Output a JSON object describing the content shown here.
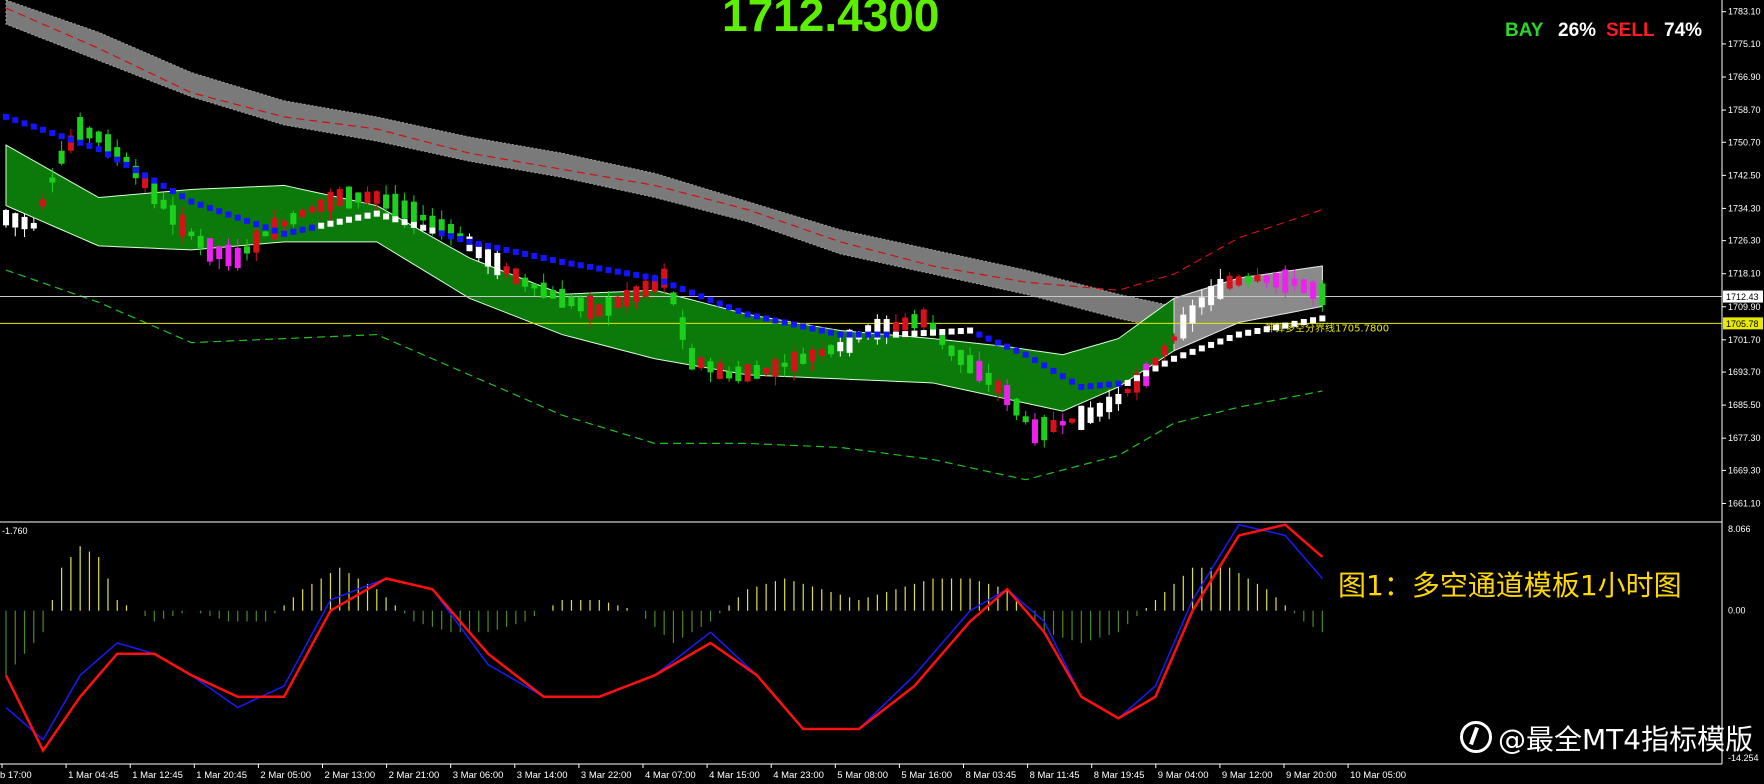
{
  "header": {
    "price": "1712.4300",
    "bay_label": "BAY",
    "bay_pct": "26%",
    "sell_label": "SELL",
    "sell_pct": "74%"
  },
  "colors": {
    "price_text": "#5cf000",
    "bay": "#28d828",
    "sell": "#ff1c1c",
    "channel_fill": "#0b7a0b",
    "cloud_fill": "#7a7a7a",
    "bull_candle": "#d8101a",
    "bear_candle": "#1cd01c",
    "trail_blue": "#1414ff",
    "trail_white": "#ffffff",
    "magenta_candle": "#ee22ee",
    "signal_line": "#ff1010",
    "macd_line": "#1a1aff",
    "hist_pos": "#e0e040",
    "hist_neg": "#4a8a20",
    "current_price_line": "#c8c8c8",
    "dividing_line": "#e8e800"
  },
  "main_axis": {
    "ylim": [
      1657,
      1786
    ],
    "ticks": [
      "1783.10",
      "1775.10",
      "1766.90",
      "1758.70",
      "1750.70",
      "1742.50",
      "1734.30",
      "1726.30",
      "1718.10",
      "1709.90",
      "1701.70",
      "1693.70",
      "1685.50",
      "1677.30",
      "1669.30",
      "1661.10"
    ],
    "current_price": 1712.43,
    "current_price_label": "1712.43",
    "dividing_price": 1705.78,
    "dividing_price_label": "1705.78",
    "dividing_line_text": "神算多空分界线1705.7800"
  },
  "time_axis": [
    "b 17:00",
    "1 Mar 04:45",
    "1 Mar 12:45",
    "1 Mar 20:45",
    "2 Mar 05:00",
    "2 Mar 13:00",
    "2 Mar 21:00",
    "3 Mar 06:00",
    "3 Mar 14:00",
    "3 Mar 22:00",
    "4 Mar 07:00",
    "4 Mar 15:00",
    "4 Mar 23:00",
    "5 Mar 08:00",
    "5 Mar 16:00",
    "8 Mar 03:45",
    "8 Mar 11:45",
    "8 Mar 19:45",
    "9 Mar 04:00",
    "9 Mar 12:00",
    "9 Mar 20:00",
    "10 Mar 05:00"
  ],
  "sub_panel": {
    "left_label": "-1.760",
    "top_label": "8.066",
    "mid_label": "0.00",
    "bottom_label": "-14.254",
    "ylim": [
      -14.254,
      8.066
    ]
  },
  "caption": "图1：多空通道模板1小时图",
  "watermark": "@最全MT4指标模版",
  "chart_data": [
    {
      "type": "candlestick",
      "title": "",
      "ylim": [
        1657,
        1786
      ],
      "x_labels": [
        "b 17:00",
        "1 Mar 04:45",
        "1 Mar 12:45",
        "1 Mar 20:45",
        "2 Mar 05:00",
        "2 Mar 13:00",
        "2 Mar 21:00",
        "3 Mar 06:00",
        "3 Mar 14:00",
        "3 Mar 22:00",
        "4 Mar 07:00",
        "4 Mar 15:00",
        "4 Mar 23:00",
        "5 Mar 08:00",
        "5 Mar 16:00",
        "8 Mar 03:45",
        "8 Mar 11:45",
        "8 Mar 19:45",
        "9 Mar 04:00",
        "9 Mar 12:00",
        "9 Mar 20:00",
        "10 Mar 05:00"
      ],
      "close_path": [
        [
          0,
          1732
        ],
        [
          3,
          1730
        ],
        [
          6,
          1747
        ],
        [
          8,
          1754
        ],
        [
          10,
          1752
        ],
        [
          13,
          1746
        ],
        [
          16,
          1738
        ],
        [
          19,
          1730
        ],
        [
          22,
          1724
        ],
        [
          25,
          1722
        ],
        [
          28,
          1728
        ],
        [
          32,
          1733
        ],
        [
          36,
          1737
        ],
        [
          40,
          1737
        ],
        [
          44,
          1733
        ],
        [
          48,
          1729
        ],
        [
          52,
          1722
        ],
        [
          56,
          1716
        ],
        [
          60,
          1712
        ],
        [
          64,
          1709
        ],
        [
          68,
          1713
        ],
        [
          71,
          1717
        ],
        [
          72,
          1712
        ],
        [
          74,
          1697
        ],
        [
          78,
          1693
        ],
        [
          82,
          1694
        ],
        [
          86,
          1697
        ],
        [
          90,
          1700
        ],
        [
          93,
          1704
        ],
        [
          96,
          1705
        ],
        [
          99,
          1707
        ],
        [
          102,
          1699
        ],
        [
          105,
          1694
        ],
        [
          108,
          1688
        ],
        [
          111,
          1679
        ],
        [
          114,
          1681
        ],
        [
          117,
          1683
        ],
        [
          120,
          1687
        ],
        [
          123,
          1693
        ],
        [
          126,
          1702
        ],
        [
          129,
          1711
        ],
        [
          132,
          1716
        ],
        [
          135,
          1717
        ],
        [
          139,
          1716
        ],
        [
          142,
          1713
        ]
      ],
      "channel_upper": [
        [
          0,
          1750
        ],
        [
          10,
          1737
        ],
        [
          20,
          1739
        ],
        [
          30,
          1740
        ],
        [
          40,
          1735
        ],
        [
          50,
          1722
        ],
        [
          60,
          1713
        ],
        [
          70,
          1714
        ],
        [
          80,
          1708
        ],
        [
          90,
          1704
        ],
        [
          100,
          1702
        ],
        [
          108,
          1700
        ],
        [
          114,
          1698
        ],
        [
          120,
          1702
        ],
        [
          126,
          1712
        ],
        [
          133,
          1717
        ],
        [
          142,
          1720
        ]
      ],
      "channel_lower": [
        [
          0,
          1735
        ],
        [
          10,
          1725
        ],
        [
          20,
          1724
        ],
        [
          30,
          1726
        ],
        [
          40,
          1726
        ],
        [
          50,
          1712
        ],
        [
          60,
          1703
        ],
        [
          70,
          1697
        ],
        [
          80,
          1693
        ],
        [
          90,
          1692
        ],
        [
          100,
          1691
        ],
        [
          108,
          1687
        ],
        [
          114,
          1684
        ],
        [
          120,
          1690
        ],
        [
          126,
          1699
        ],
        [
          133,
          1706
        ],
        [
          142,
          1710
        ]
      ],
      "trail_line": [
        [
          0,
          1757
        ],
        [
          10,
          1749
        ],
        [
          20,
          1736
        ],
        [
          30,
          1728
        ],
        [
          40,
          1733
        ],
        [
          50,
          1726
        ],
        [
          60,
          1721
        ],
        [
          70,
          1717
        ],
        [
          80,
          1708
        ],
        [
          90,
          1703
        ],
        [
          96,
          1703
        ],
        [
          104,
          1704
        ],
        [
          110,
          1698
        ],
        [
          116,
          1690
        ],
        [
          121,
          1691
        ],
        [
          126,
          1697
        ],
        [
          133,
          1703
        ],
        [
          142,
          1707
        ]
      ],
      "cloud_upper": [
        [
          0,
          1786
        ],
        [
          10,
          1778
        ],
        [
          20,
          1768
        ],
        [
          30,
          1761
        ],
        [
          40,
          1757
        ],
        [
          50,
          1752
        ],
        [
          60,
          1748
        ],
        [
          70,
          1743
        ],
        [
          80,
          1736
        ],
        [
          90,
          1729
        ],
        [
          100,
          1724
        ],
        [
          110,
          1719
        ],
        [
          120,
          1713
        ],
        [
          126,
          1710
        ]
      ],
      "cloud_lower": [
        [
          0,
          1780
        ],
        [
          10,
          1771
        ],
        [
          20,
          1762
        ],
        [
          30,
          1755
        ],
        [
          40,
          1751
        ],
        [
          50,
          1746
        ],
        [
          60,
          1742
        ],
        [
          70,
          1737
        ],
        [
          80,
          1731
        ],
        [
          90,
          1723
        ],
        [
          100,
          1718
        ],
        [
          110,
          1713
        ],
        [
          120,
          1707
        ],
        [
          126,
          1704
        ]
      ],
      "outer_upper_dashed": [
        [
          0,
          1784
        ],
        [
          10,
          1774
        ],
        [
          20,
          1763
        ],
        [
          30,
          1757
        ],
        [
          40,
          1754
        ],
        [
          50,
          1748
        ],
        [
          60,
          1744
        ],
        [
          70,
          1740
        ],
        [
          80,
          1734
        ],
        [
          90,
          1726
        ],
        [
          100,
          1720
        ],
        [
          110,
          1716
        ],
        [
          120,
          1714
        ],
        [
          126,
          1718
        ],
        [
          133,
          1727
        ],
        [
          142,
          1734
        ]
      ],
      "outer_lower_dashed": [
        [
          0,
          1719
        ],
        [
          10,
          1711
        ],
        [
          20,
          1701
        ],
        [
          30,
          1702
        ],
        [
          40,
          1703
        ],
        [
          50,
          1693
        ],
        [
          60,
          1683
        ],
        [
          70,
          1676
        ],
        [
          80,
          1676
        ],
        [
          90,
          1675
        ],
        [
          100,
          1672
        ],
        [
          110,
          1667
        ],
        [
          120,
          1673
        ],
        [
          126,
          1681
        ],
        [
          133,
          1685
        ],
        [
          142,
          1689
        ]
      ],
      "candle_count": 143
    },
    {
      "type": "line",
      "title": "",
      "ylim": [
        -14.254,
        8.066
      ],
      "series": [
        {
          "values": [
            [
              0,
              -6
            ],
            [
              4,
              -13
            ],
            [
              8,
              -8
            ],
            [
              12,
              -4
            ],
            [
              16,
              -4
            ],
            [
              20,
              -6
            ],
            [
              25,
              -8
            ],
            [
              30,
              -8
            ],
            [
              35,
              0
            ],
            [
              41,
              3
            ],
            [
              46,
              2
            ],
            [
              52,
              -4
            ],
            [
              58,
              -8
            ],
            [
              64,
              -8
            ],
            [
              70,
              -6
            ],
            [
              76,
              -3
            ],
            [
              81,
              -6
            ],
            [
              86,
              -11
            ],
            [
              92,
              -11
            ],
            [
              98,
              -7
            ],
            [
              104,
              -1
            ],
            [
              108,
              2
            ],
            [
              112,
              -2
            ],
            [
              116,
              -8
            ],
            [
              120,
              -10
            ],
            [
              124,
              -8
            ],
            [
              128,
              0
            ],
            [
              133,
              7
            ],
            [
              138,
              8
            ],
            [
              142,
              5
            ]
          ]
        },
        {
          "values": [
            [
              0,
              -9
            ],
            [
              4,
              -12
            ],
            [
              8,
              -6
            ],
            [
              12,
              -3
            ],
            [
              16,
              -4
            ],
            [
              20,
              -6
            ],
            [
              25,
              -9
            ],
            [
              30,
              -7
            ],
            [
              35,
              1
            ],
            [
              41,
              3
            ],
            [
              46,
              2
            ],
            [
              52,
              -5
            ],
            [
              58,
              -8
            ],
            [
              64,
              -8
            ],
            [
              70,
              -6
            ],
            [
              76,
              -2
            ],
            [
              81,
              -6
            ],
            [
              86,
              -11
            ],
            [
              92,
              -11
            ],
            [
              98,
              -6
            ],
            [
              104,
              0
            ],
            [
              108,
              2
            ],
            [
              112,
              -1
            ],
            [
              116,
              -8
            ],
            [
              120,
              -10
            ],
            [
              124,
              -7
            ],
            [
              128,
              1
            ],
            [
              133,
              8
            ],
            [
              138,
              7
            ],
            [
              142,
              3
            ]
          ]
        }
      ],
      "histogram": [
        [
          0,
          -6
        ],
        [
          4,
          -2
        ],
        [
          6,
          4
        ],
        [
          8,
          6
        ],
        [
          10,
          5
        ],
        [
          12,
          1
        ],
        [
          16,
          -1
        ],
        [
          20,
          0
        ],
        [
          24,
          -1
        ],
        [
          28,
          -1
        ],
        [
          32,
          2
        ],
        [
          36,
          4
        ],
        [
          40,
          2
        ],
        [
          44,
          -1
        ],
        [
          48,
          -2
        ],
        [
          52,
          -2
        ],
        [
          56,
          -1
        ],
        [
          60,
          1
        ],
        [
          64,
          1
        ],
        [
          68,
          0
        ],
        [
          72,
          -3
        ],
        [
          76,
          -1
        ],
        [
          80,
          2
        ],
        [
          84,
          3
        ],
        [
          88,
          2
        ],
        [
          92,
          1
        ],
        [
          96,
          2
        ],
        [
          100,
          3
        ],
        [
          104,
          3
        ],
        [
          108,
          2
        ],
        [
          112,
          -2
        ],
        [
          116,
          -3
        ],
        [
          120,
          -2
        ],
        [
          124,
          1
        ],
        [
          128,
          4
        ],
        [
          132,
          4
        ],
        [
          136,
          2
        ],
        [
          140,
          -1
        ],
        [
          142,
          -2
        ]
      ]
    }
  ]
}
